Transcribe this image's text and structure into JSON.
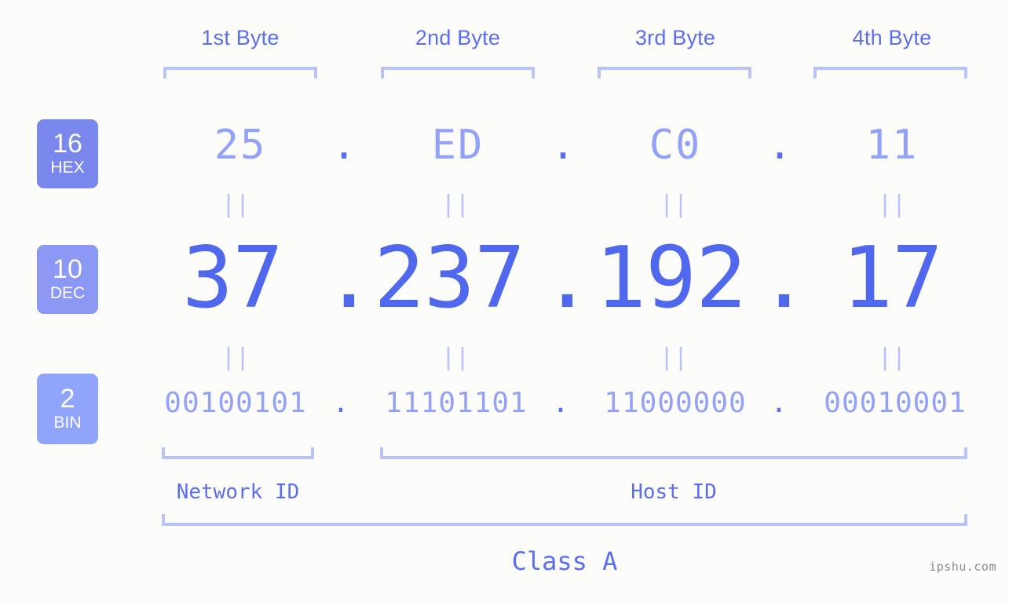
{
  "page": {
    "background": "#fcfdfa",
    "accent_strong": "#5068ee",
    "accent_mid": "#5b6ef0",
    "accent_light": "#93a1f7",
    "accent_pale": "#b9c2f9",
    "watermark": "ipshu.com"
  },
  "byte_headers": [
    {
      "label": "1st Byte"
    },
    {
      "label": "2nd Byte"
    },
    {
      "label": "3rd Byte"
    },
    {
      "label": "4th Byte"
    }
  ],
  "bases": [
    {
      "id": "hex",
      "number": "16",
      "name": "HEX",
      "color": "#7a87ec"
    },
    {
      "id": "dec",
      "number": "10",
      "name": "DEC",
      "color": "#8b98f4"
    },
    {
      "id": "bin",
      "number": "2",
      "name": "BIN",
      "color": "#8fa4fa"
    }
  ],
  "rows": {
    "hex": {
      "values": [
        "25",
        "ED",
        "C0",
        "11"
      ],
      "separator": "."
    },
    "dec": {
      "values": [
        "37",
        "237",
        "192",
        "17"
      ],
      "separator": "."
    },
    "bin": {
      "values": [
        "00100101",
        "11101101",
        "11000000",
        "00010001"
      ],
      "separator": "."
    }
  },
  "equality_marker": "||",
  "segments": {
    "network_id": "Network ID",
    "host_id": "Host ID",
    "class": "Class A"
  },
  "address": {
    "dotted_decimal": "37.237.192.17",
    "hexadecimal": "25.ED.C0.11",
    "binary": "00100101.11101101.11000000.00010001",
    "class": "Class A"
  }
}
